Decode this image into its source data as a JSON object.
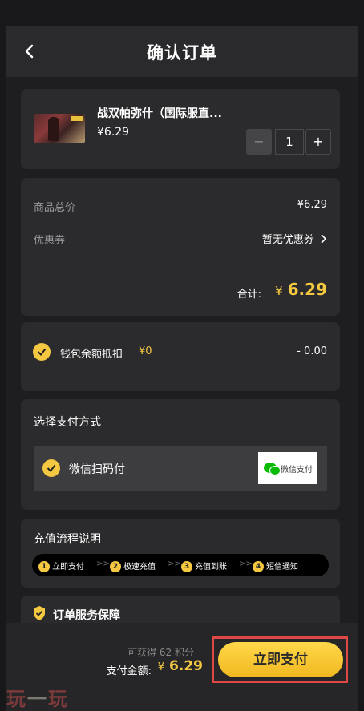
{
  "header": {
    "title": "确认订单",
    "back_icon": "chevron-left-icon"
  },
  "product": {
    "name": "战双帕弥什（国际服直...",
    "price": "¥6.29",
    "quantity": "1",
    "minus": "−",
    "plus": "+"
  },
  "summary": {
    "subtotal_label": "商品总价",
    "subtotal_value": "¥6.29",
    "coupon_label": "优惠券",
    "coupon_value": "暂无优惠券",
    "total_label": "合计:",
    "total_currency": "¥",
    "total_value": "6.29"
  },
  "wallet": {
    "label": "钱包余额抵扣",
    "balance": "¥0",
    "deduct": "- 0.00",
    "checked": true
  },
  "payment": {
    "section_title": "选择支付方式",
    "method_label": "微信扫码付",
    "method_logo_text": "微信支付",
    "checked": true
  },
  "flow": {
    "title": "充值流程说明",
    "steps": [
      {
        "num": "1",
        "label": "立即支付"
      },
      {
        "num": "2",
        "label": "极速充值"
      },
      {
        "num": "3",
        "label": "充值到账"
      },
      {
        "num": "4",
        "label": "短信通知"
      }
    ],
    "separator": ">>"
  },
  "guarantee": {
    "title": "订单服务保障"
  },
  "footer": {
    "points": "可获得 62 积分",
    "pay_label": "支付金额:",
    "pay_currency": "¥",
    "pay_value": "6.29",
    "pay_button": "立即支付"
  },
  "watermark": {
    "part1": "玩",
    "part2": "一",
    "part3": "玩"
  },
  "colors": {
    "accent": "#f5c842",
    "highlight_frame": "#e04848",
    "background": "#1e1e20",
    "card": "#2b2b2d"
  }
}
